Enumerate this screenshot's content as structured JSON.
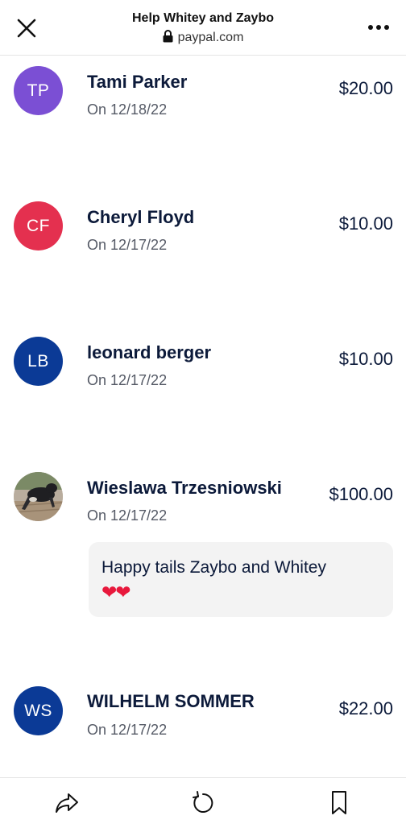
{
  "header": {
    "title": "Help Whitey and Zaybo",
    "url": "paypal.com",
    "close_icon": "close-icon",
    "more_icon": "more-options-icon",
    "lock_icon": "lock-icon"
  },
  "donors": [
    {
      "initials": "TP",
      "name": "Tami Parker",
      "date": "On 12/18/22",
      "amount": "$20.00",
      "avatar_color": "#7b4fd4"
    },
    {
      "initials": "CF",
      "name": "Cheryl Floyd",
      "date": "On 12/17/22",
      "amount": "$10.00",
      "avatar_color": "#e4304f"
    },
    {
      "initials": "LB",
      "name": "leonard berger",
      "date": "On 12/17/22",
      "amount": "$10.00",
      "avatar_color": "#0b3a96"
    },
    {
      "initials": "",
      "name": "Wieslawa Trzesniowski",
      "date": "On 12/17/22",
      "amount": "$100.00",
      "avatar_color": "#c8bdb0",
      "message": "Happy tails Zaybo and Whitey",
      "message_emoji": "❤❤"
    },
    {
      "initials": "WS",
      "name": "WILHELM SOMMER",
      "date": "On 12/17/22",
      "amount": "$22.00",
      "avatar_color": "#0b3a96"
    }
  ],
  "bottom_bar": {
    "icons": [
      "share-icon",
      "refresh-icon",
      "bookmark-icon"
    ]
  }
}
